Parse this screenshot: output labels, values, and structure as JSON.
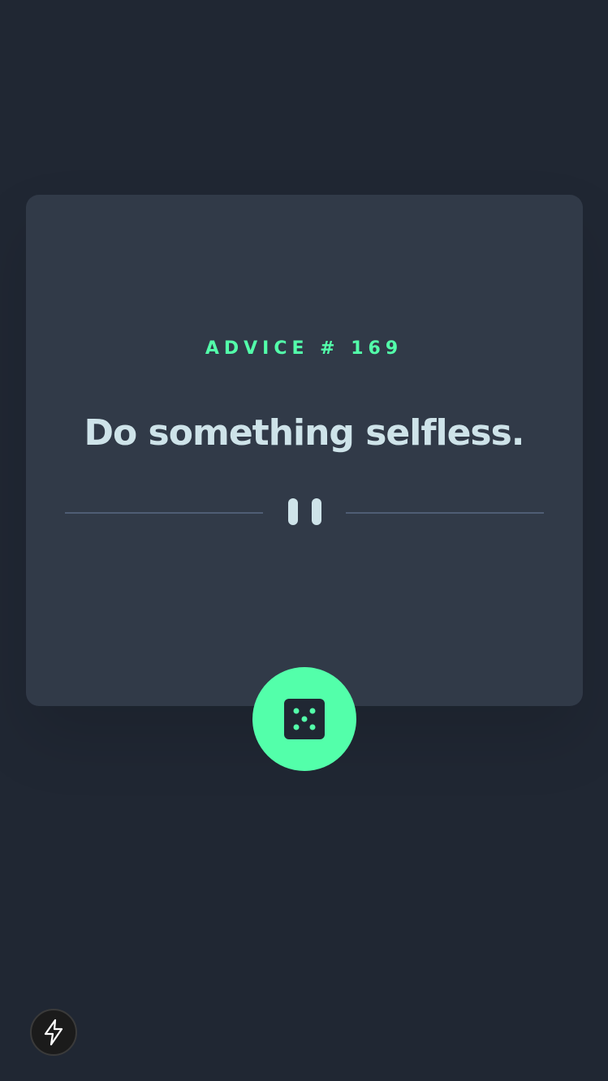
{
  "advice": {
    "label": "ADVICE # 169",
    "quote": "Do something selfless."
  },
  "icons": {
    "divider": "pause-icon",
    "dice_button": "dice-icon",
    "corner_button": "lightning-bolt-icon"
  },
  "colors": {
    "background": "#202733",
    "card": "#313a48",
    "accent": "#53ffaa",
    "text": "#cee3e9",
    "divider": "#4f5d74"
  }
}
